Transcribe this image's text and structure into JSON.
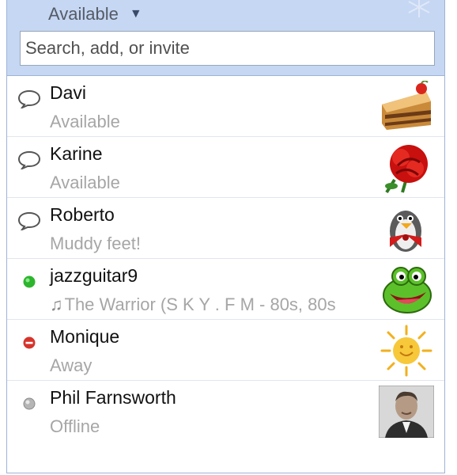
{
  "header": {
    "status_label": "Available",
    "status_caret": "▼"
  },
  "search": {
    "placeholder": "Search, add, or invite",
    "value": ""
  },
  "colors": {
    "header_bg": "#c6d7f3",
    "online_green": "#2db52d",
    "busy_red": "#d6342b",
    "offline_gray": "#9a9a9a"
  },
  "contacts": [
    {
      "name": "Davi",
      "status_text": "Available",
      "status_icon": "chat-bubble-icon",
      "avatar": "cake-avatar"
    },
    {
      "name": "Karine",
      "status_text": "Available",
      "status_icon": "chat-bubble-icon",
      "avatar": "red-rose-avatar"
    },
    {
      "name": "Roberto",
      "status_text": "Muddy feet!",
      "status_icon": "chat-bubble-icon",
      "avatar": "penguin-avatar"
    },
    {
      "name": "jazzguitar9",
      "status_text": "The Warrior (S K Y . F M - 80s, 80s",
      "status_icon": "green-dot-icon",
      "status_prefix_icon": "music-note-icon",
      "avatar": "green-frog-avatar"
    },
    {
      "name": "Monique",
      "status_text": "Away",
      "status_icon": "red-busy-icon",
      "avatar": "sun-avatar"
    },
    {
      "name": "Phil Farnsworth",
      "status_text": "Offline",
      "status_icon": "gray-dot-icon",
      "avatar": "man-photo-avatar"
    }
  ]
}
